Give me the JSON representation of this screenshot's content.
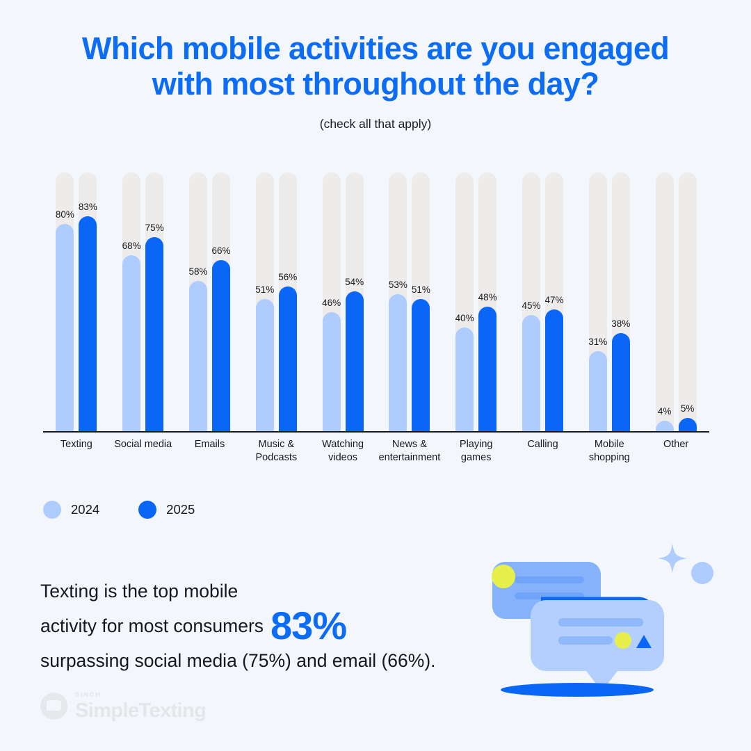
{
  "header": {
    "title": "Which mobile activities are you engaged\nwith most throughout the day?",
    "subtitle": "(check all that apply)"
  },
  "legend": {
    "items": [
      {
        "label": "2024",
        "color": "#aecdfe"
      },
      {
        "label": "2025",
        "color": "#0a66f6"
      }
    ]
  },
  "footnote": {
    "line1": "Texting is the top mobile",
    "line2a": "activity for most consumers",
    "big": "83%",
    "line3": "surpassing social media (75%) and email (66%)."
  },
  "logo": {
    "sinch": "SINCH",
    "name": "SimpleTexting"
  },
  "chart_data": {
    "type": "bar",
    "title": "Which mobile activities are you engaged with most throughout the day?",
    "subtitle": "(check all that apply)",
    "xlabel": "",
    "ylabel": "",
    "ylim": [
      0,
      100
    ],
    "grid": false,
    "legend_position": "bottom-left",
    "value_suffix": "%",
    "categories": [
      "Texting",
      "Social media",
      "Emails",
      "Music &\nPodcasts",
      "Watching\nvideos",
      "News &\nentertainment",
      "Playing\ngames",
      "Calling",
      "Mobile\nshopping",
      "Other"
    ],
    "series": [
      {
        "name": "2024",
        "color": "#aecdfe",
        "values": [
          80,
          68,
          58,
          51,
          46,
          53,
          40,
          45,
          31,
          4
        ],
        "labels": [
          "80%",
          "68%",
          "58%",
          "51%",
          "46%",
          "53%",
          "40%",
          "45%",
          "31%",
          "4%"
        ]
      },
      {
        "name": "2025",
        "color": "#0a66f6",
        "values": [
          83,
          75,
          66,
          56,
          54,
          51,
          48,
          47,
          38,
          5
        ],
        "labels": [
          "83%",
          "75%",
          "66%",
          "56%",
          "54%",
          "51%",
          "48%",
          "47%",
          "38%",
          "5%"
        ]
      }
    ]
  }
}
